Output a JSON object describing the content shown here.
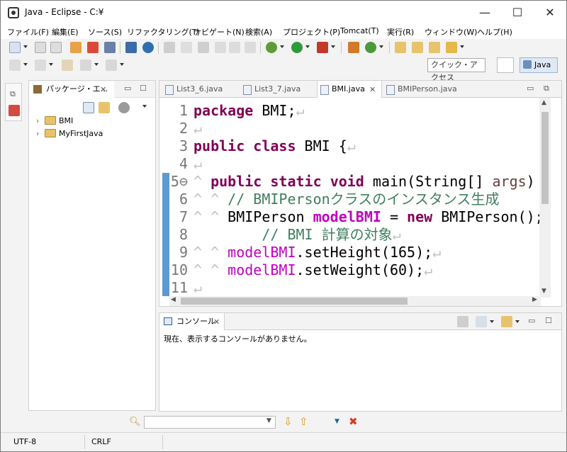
{
  "window": {
    "title": "Java - Eclipse - C:¥",
    "minimize": "—",
    "maximize": "☐",
    "close": "✕"
  },
  "menu": [
    "ファイル(F)",
    "編集(E)",
    "ソース(S)",
    "リファクタリング(T)",
    "ナビゲート(N)",
    "検索(A)",
    "プロジェクト(P)",
    "Tomcat(T)",
    "実行(R)",
    "ウィンドウ(W)",
    "ヘルプ(H)"
  ],
  "toolbar": {
    "quick_access": "クイック・アクセス",
    "perspective": "Java"
  },
  "package_explorer": {
    "tab_label": "パッケージ・エ...",
    "items": [
      {
        "label": "BMI",
        "expand": "›"
      },
      {
        "label": "MyFirstJava",
        "expand": "›"
      }
    ]
  },
  "editor": {
    "tabs": [
      "List3_6.java",
      "List3_7.java",
      "BMI.java",
      "BMIPerson.java"
    ],
    "active_tab": "BMI.java",
    "lines": [
      {
        "n": "1",
        "parts": [
          [
            "kw",
            "package"
          ],
          [
            "t",
            " BMI;"
          ],
          [
            "ws",
            "↵"
          ]
        ]
      },
      {
        "n": "2",
        "parts": [
          [
            "ws",
            "↵"
          ]
        ]
      },
      {
        "n": "3",
        "parts": [
          [
            "kw",
            "public"
          ],
          [
            "t",
            " "
          ],
          [
            "kw",
            "class"
          ],
          [
            "t",
            " BMI {"
          ],
          [
            "ws",
            "↵"
          ]
        ]
      },
      {
        "n": "4",
        "parts": [
          [
            "ws",
            "↵"
          ]
        ]
      },
      {
        "n": "5⊖",
        "parts": [
          [
            "ws",
            "^ "
          ],
          [
            "kw",
            "public"
          ],
          [
            "t",
            " "
          ],
          [
            "kw",
            "static"
          ],
          [
            "t",
            " "
          ],
          [
            "kw",
            "void"
          ],
          [
            "t",
            " main(String[] "
          ],
          [
            "arg",
            "args"
          ],
          [
            "t",
            ")"
          ]
        ]
      },
      {
        "n": "6",
        "parts": [
          [
            "ws",
            "^ ^ "
          ],
          [
            "cmt",
            "// BMIPersonクラスのインスタンス生成"
          ]
        ]
      },
      {
        "n": "7",
        "parts": [
          [
            "ws",
            "^ ^ "
          ],
          [
            "t",
            "BMIPerson "
          ],
          [
            "fldb",
            "modelBMI"
          ],
          [
            "t",
            " = "
          ],
          [
            "kw",
            "new"
          ],
          [
            "t",
            " BMIPerson();"
          ]
        ]
      },
      {
        "n": "8",
        "parts": [
          [
            "t",
            "        "
          ],
          [
            "cmt",
            "// BMI 計算の対象"
          ],
          [
            "ws",
            "↵"
          ]
        ]
      },
      {
        "n": "9",
        "parts": [
          [
            "ws",
            "^ ^ "
          ],
          [
            "fld",
            "modelBMI"
          ],
          [
            "t",
            ".setHeight(165);"
          ],
          [
            "ws",
            "↵"
          ]
        ]
      },
      {
        "n": "10",
        "parts": [
          [
            "ws",
            "^ ^ "
          ],
          [
            "fld",
            "modelBMI"
          ],
          [
            "t",
            ".setWeight(60);"
          ],
          [
            "ws",
            "↵"
          ]
        ]
      },
      {
        "n": "11",
        "parts": [
          [
            "ws",
            "↵"
          ]
        ]
      }
    ]
  },
  "console": {
    "tab_label": "コンソール",
    "message": "現在、表示するコンソールがありません。"
  },
  "statusbar": {
    "encoding": "UTF-8",
    "line_delimiter": "CRLF"
  },
  "colors": {
    "keyword": "#7f0055",
    "field": "#c000c0",
    "comment": "#3f7f5f",
    "args": "#7f0055"
  }
}
